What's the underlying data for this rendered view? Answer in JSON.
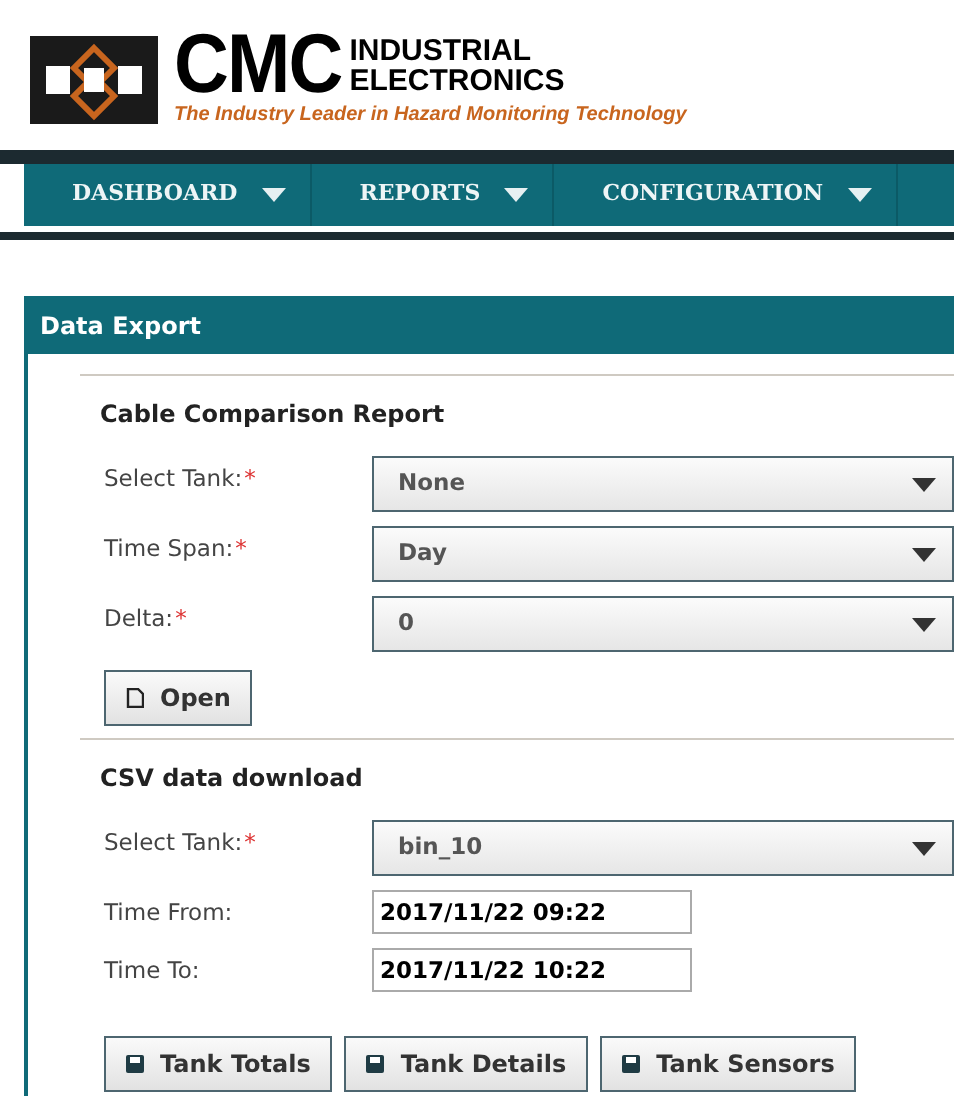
{
  "logo": {
    "wordmark": "CMC",
    "line_1": "INDUSTRIAL",
    "line_2": "ELECTRONICS",
    "tagline": "The Industry Leader in Hazard Monitoring Technology"
  },
  "nav": [
    {
      "label": "DASHBOARD"
    },
    {
      "label": "REPORTS"
    },
    {
      "label": "CONFIGURATION"
    }
  ],
  "panel": {
    "title": "Data Export",
    "sections": [
      {
        "heading": "Cable Comparison Report",
        "fields": [
          {
            "kind": "select",
            "label": "Select Tank:",
            "required_mark": "*",
            "value": "None"
          },
          {
            "kind": "select",
            "label": "Time Span:",
            "required_mark": "*",
            "value": "Day"
          },
          {
            "kind": "select",
            "label": "Delta:",
            "required_mark": "*",
            "value": "0"
          }
        ],
        "buttons": [
          {
            "label": "Open",
            "kind": "file"
          }
        ]
      },
      {
        "heading": "CSV data download",
        "fields": [
          {
            "kind": "select",
            "label": "Select Tank:",
            "required_mark": "*",
            "value": "bin_10"
          },
          {
            "kind": "text",
            "label": "Time From:",
            "value": "2017/11/22 09:22"
          },
          {
            "kind": "text",
            "label": "Time To:",
            "value": "2017/11/22 10:22"
          }
        ],
        "buttons": [
          {
            "label": "Tank Totals",
            "kind": "save"
          },
          {
            "label": "Tank Details",
            "kind": "save"
          },
          {
            "label": "Tank Sensors",
            "kind": "save"
          }
        ]
      }
    ]
  }
}
